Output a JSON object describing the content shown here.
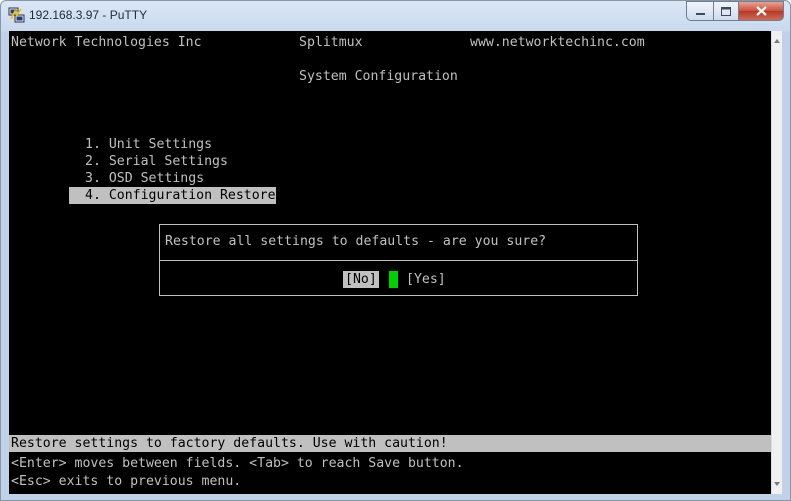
{
  "window": {
    "title": "192.168.3.97 - PuTTY"
  },
  "terminal": {
    "header": {
      "company": "Network Technologies Inc",
      "product": "Splitmux",
      "website": "www.networktechinc.com"
    },
    "screen_title": "System Configuration",
    "menu": [
      "1. Unit Settings",
      "2. Serial Settings",
      "3. OSD Settings",
      "4. Configuration Restore"
    ],
    "selected_menu_index": 3,
    "dialog": {
      "message": "Restore all settings to defaults - are you sure?",
      "no_label": "[No]",
      "yes_label": "[Yes]"
    },
    "status_line": "Restore settings to factory defaults. Use with caution!",
    "help_lines": [
      "<Enter> moves between fields. <Tab> to reach Save button.",
      "<Esc> exits to previous menu."
    ]
  },
  "colors": {
    "terminal_bg": "#000000",
    "terminal_fg": "#c0c0c0",
    "highlight_bg": "#c0c0c0",
    "cursor": "#00d000"
  }
}
